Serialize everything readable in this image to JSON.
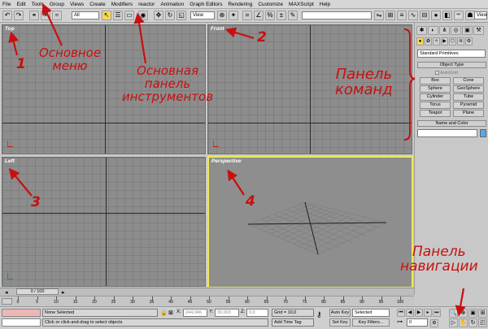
{
  "menu": [
    "File",
    "Edit",
    "Tools",
    "Group",
    "Views",
    "Create",
    "Modifiers",
    "reactor",
    "Animation",
    "Graph Editors",
    "Rendering",
    "Customize",
    "MAXScript",
    "Help"
  ],
  "toolbar": {
    "filter_select": "All",
    "coord_select": "View",
    "named_selection": "",
    "view_right": "View"
  },
  "viewports": {
    "top": "Top",
    "front": "Front",
    "left": "Left",
    "perspective": "Perspective"
  },
  "command_panel": {
    "category": "Standard Primitives",
    "object_type_title": "Object Type",
    "autogrid": "AutoGrid",
    "buttons": [
      "Box",
      "Cone",
      "Sphere",
      "GeoSphere",
      "Cylinder",
      "Tube",
      "Torus",
      "Pyramid",
      "Teapot",
      "Plane"
    ],
    "name_color_title": "Name and Color"
  },
  "timeline": {
    "frame": "0 / 100",
    "ticks": [
      "0",
      "5",
      "10",
      "15",
      "20",
      "25",
      "30",
      "35",
      "40",
      "45",
      "50",
      "55",
      "60",
      "65",
      "70",
      "75",
      "80",
      "85",
      "90",
      "95",
      "100"
    ]
  },
  "status": {
    "selection": "None Selected",
    "prompt": "Click or click-and-drag to select objects",
    "x_label": "X:",
    "x_value": "244,046",
    "y_label": "Y:",
    "y_value": "30,003",
    "z_label": "Z:",
    "z_value": "0,0",
    "grid": "Grid = 10,0",
    "add_time_tag": "Add Time Tag",
    "auto_key": "Auto Key",
    "set_key": "Set Key",
    "key_mode": "Selected",
    "key_filters": "Key Filters...",
    "frame_field": "0"
  },
  "annotations": {
    "n1": "1",
    "n2": "2",
    "n3": "3",
    "n4": "4",
    "main_menu": "Основное\nменю",
    "main_toolbar": "Основная\nпанель\nинструментов",
    "command_panel": "Панель\nкоманд",
    "nav_panel": "Панель\nнавигации"
  },
  "colors": {
    "annotation": "#c81010",
    "active_viewport_border": "#ede75f",
    "viewport_bg": "#8d8d8d",
    "swatch": "#56a8e8"
  }
}
